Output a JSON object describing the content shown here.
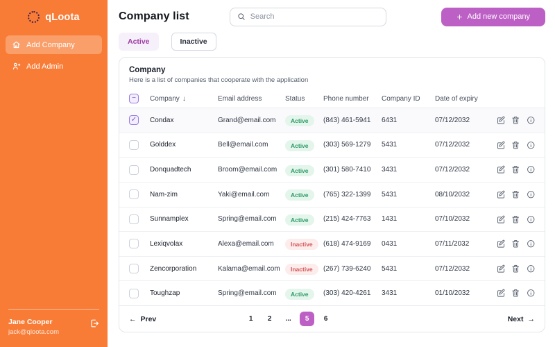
{
  "colors": {
    "sidebar_orange": "#f87c36",
    "accent_purple": "#bd60c6",
    "status_active_text": "#2d9b66",
    "status_active_bg": "#e4f5ec",
    "status_inactive_text": "#d45555",
    "status_inactive_bg": "#fcecec",
    "checkbox_purple": "#7a55d6"
  },
  "sidebar": {
    "brand": "qLoota",
    "nav": [
      {
        "label": "Add Company",
        "icon": "home-icon",
        "active": true
      },
      {
        "label": "Add Admin",
        "icon": "person-plus-icon",
        "active": false
      }
    ],
    "user": {
      "name": "Jane Cooper",
      "email": "jack@qloota.com"
    }
  },
  "header": {
    "title": "Company list",
    "search_placeholder": "Search",
    "add_button_label": "Add new company",
    "plus_glyph": "+"
  },
  "tabs": [
    {
      "label": "Active",
      "active": true
    },
    {
      "label": "Inactive",
      "active": false
    }
  ],
  "table": {
    "title": "Company",
    "subtitle": "Here is a list of companies that cooperate with the application",
    "header_checkbox_state": "indeterminate",
    "sort_glyph": "↓",
    "columns": [
      "Company",
      "Email address",
      "Status",
      "Phone number",
      "Company ID",
      "Date of expiry"
    ],
    "rows": [
      {
        "checked": true,
        "company": "Condax",
        "email": "Grand@email.com",
        "status": "Active",
        "phone": "(843) 461-5941",
        "company_id": "6431",
        "expiry": "07/12/2032"
      },
      {
        "checked": false,
        "company": "Golddex",
        "email": "Bell@email.com",
        "status": "Active",
        "phone": "(303) 569-1279",
        "company_id": "5431",
        "expiry": "07/12/2032"
      },
      {
        "checked": false,
        "company": "Donquadtech",
        "email": "Broom@email.com",
        "status": "Active",
        "phone": "(301) 580-7410",
        "company_id": "3431",
        "expiry": "07/12/2032"
      },
      {
        "checked": false,
        "company": "Nam-zim",
        "email": "Yaki@email.com",
        "status": "Active",
        "phone": "(765) 322-1399",
        "company_id": "5431",
        "expiry": "08/10/2032"
      },
      {
        "checked": false,
        "company": "Sunnamplex",
        "email": "Spring@email.com",
        "status": "Active",
        "phone": "(215) 424-7763",
        "company_id": "1431",
        "expiry": "07/10/2032"
      },
      {
        "checked": false,
        "company": "Lexiqvolax",
        "email": "Alexa@email.com",
        "status": "Inactive",
        "phone": "(618) 474-9169",
        "company_id": "0431",
        "expiry": "07/11/2032"
      },
      {
        "checked": false,
        "company": "Zencorporation",
        "email": "Kalama@email.com",
        "status": "Inactive",
        "phone": "(267) 739-6240",
        "company_id": "5431",
        "expiry": "07/12/2032"
      },
      {
        "checked": false,
        "company": "Toughzap",
        "email": "Spring@email.com",
        "status": "Active",
        "phone": "(303) 420-4261",
        "company_id": "3431",
        "expiry": "01/10/2032"
      }
    ]
  },
  "pagination": {
    "prev_label": "Prev",
    "next_label": "Next",
    "arrow_left": "←",
    "arrow_right": "→",
    "pages": [
      "1",
      "2",
      "...",
      "5",
      "6"
    ],
    "current_page": "5"
  }
}
